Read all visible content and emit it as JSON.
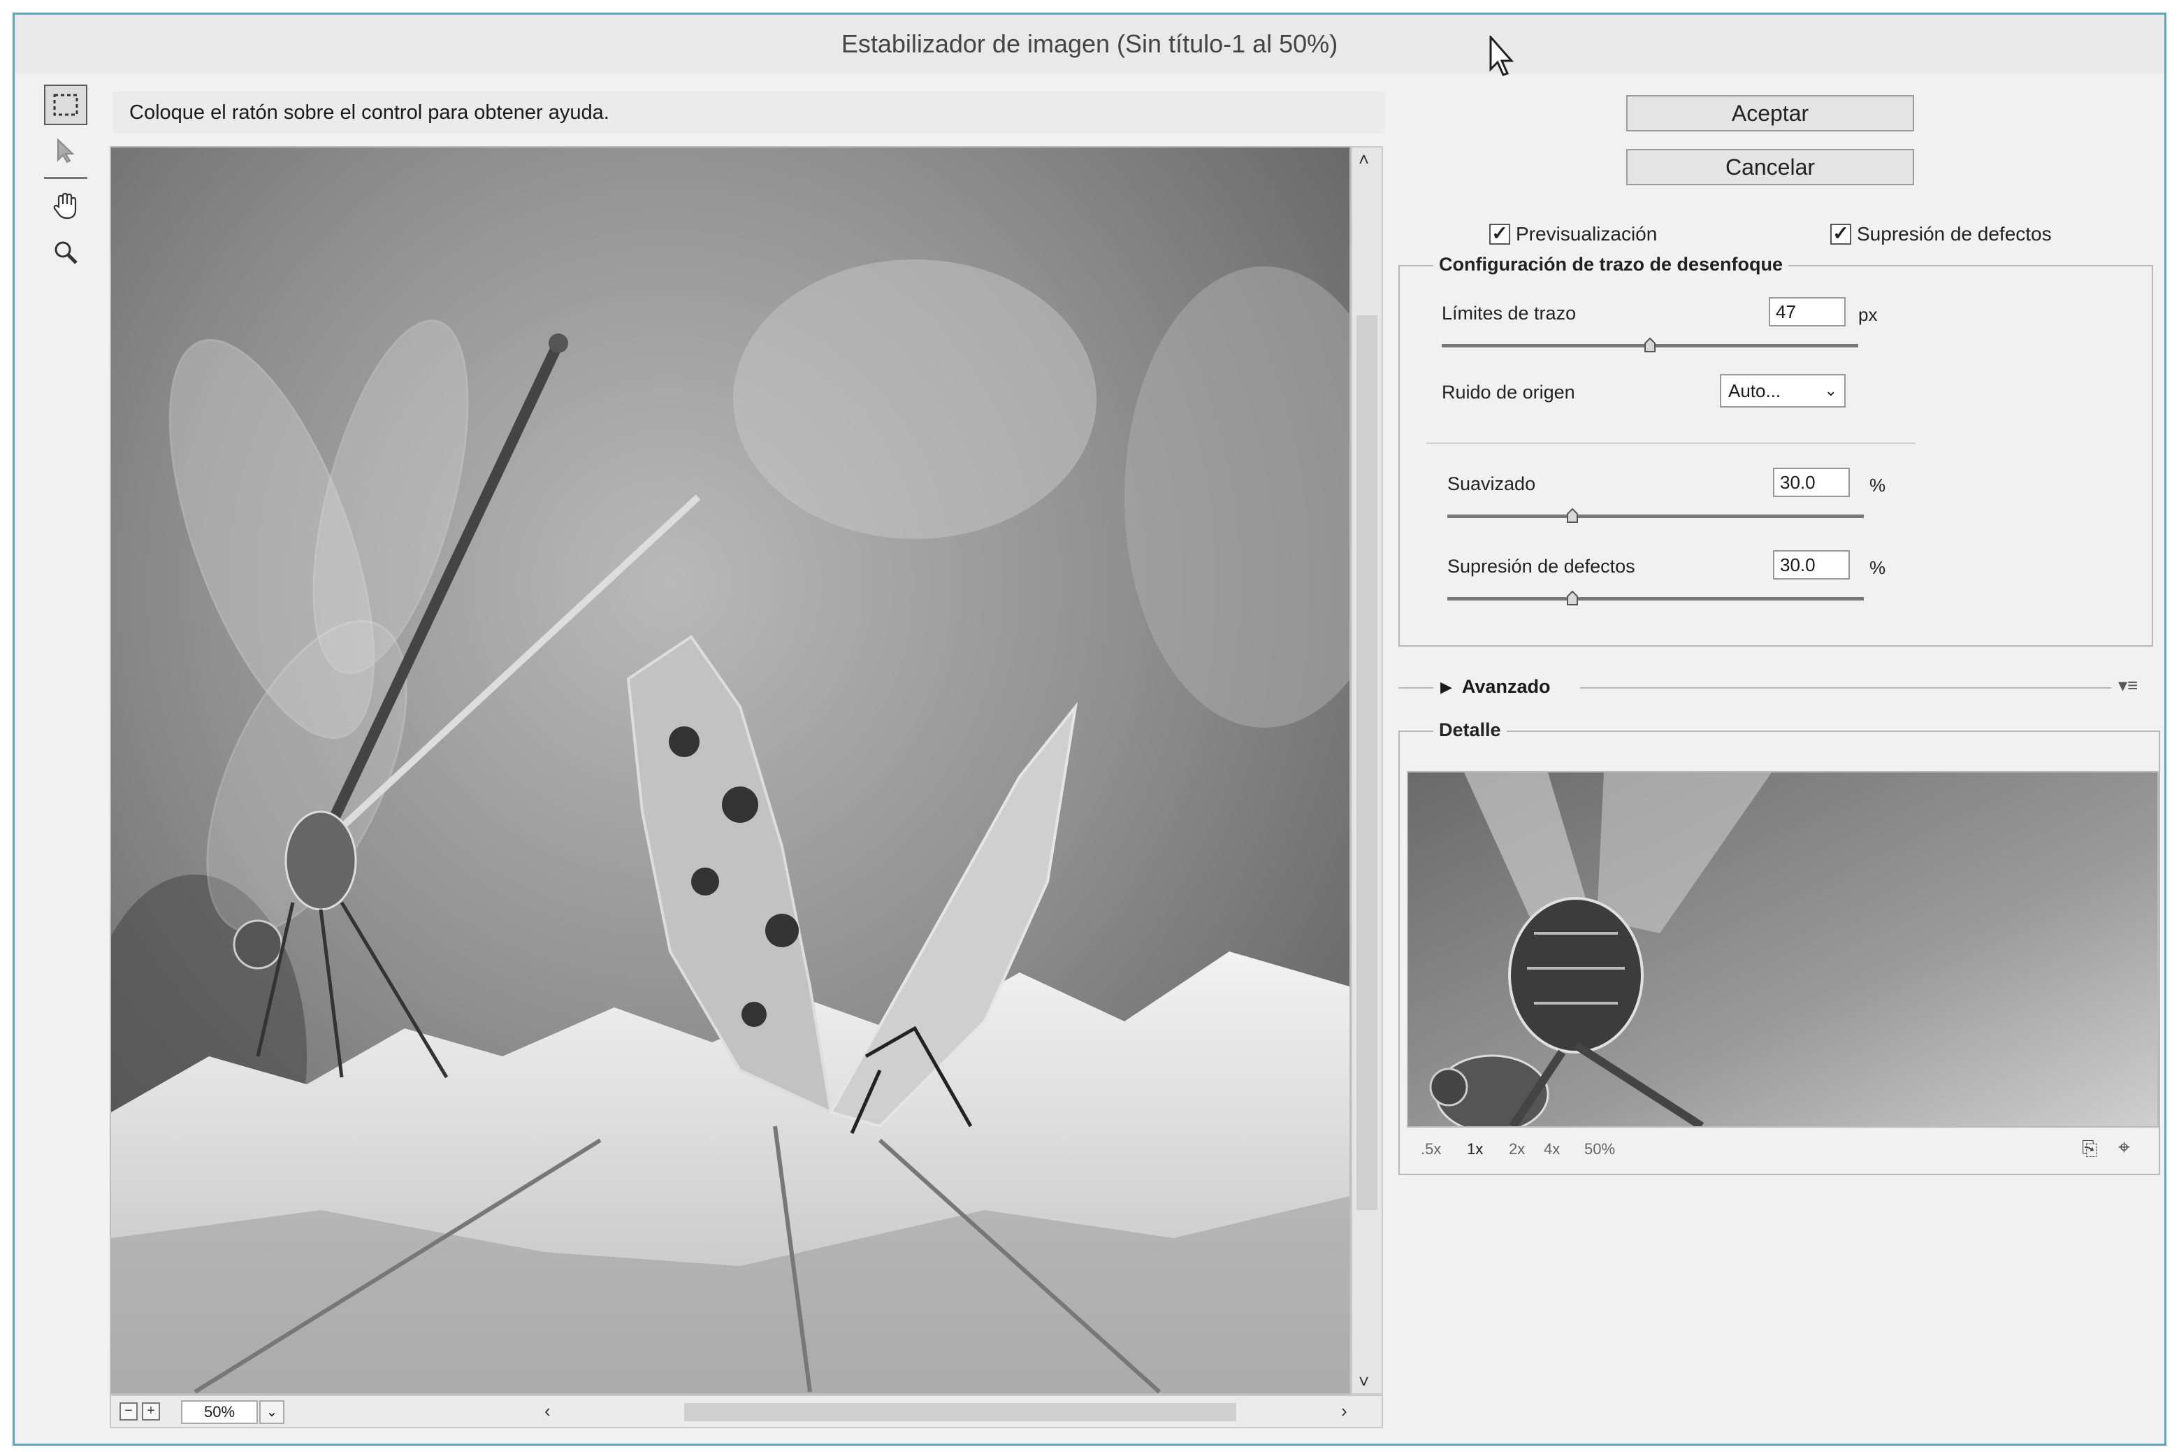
{
  "window": {
    "title": "Estabilizador de imagen (Sin título-1 al 50%)"
  },
  "help_text": "Coloque el ratón sobre el control para obtener ayuda.",
  "tools": [
    {
      "icon": "marquee-select-icon"
    },
    {
      "icon": "pointer-arrow-icon"
    },
    {
      "icon": "hand-icon"
    },
    {
      "icon": "zoom-icon"
    }
  ],
  "buttons": {
    "ok": "Aceptar",
    "cancel": "Cancelar"
  },
  "checkboxes": {
    "preview": {
      "label": "Previsualización",
      "checked": true
    },
    "artifact": {
      "label": "Supresión de defectos",
      "checked": true
    }
  },
  "blur_group": {
    "title": "Configuración de trazo de desenfoque",
    "trace_bounds": {
      "label": "Límites de trazo",
      "value": "47",
      "unit": "px",
      "slider_fraction": 0.5
    },
    "source_noise": {
      "label": "Ruido de origen",
      "value": "Auto..."
    },
    "smoothing": {
      "label": "Suavizado",
      "value": "30.0",
      "unit": "%",
      "slider_fraction": 0.3
    },
    "artifact_suppression": {
      "label": "Supresión de defectos",
      "value": "30.0",
      "unit": "%",
      "slider_fraction": 0.3
    }
  },
  "advanced": {
    "label": "Avanzado"
  },
  "detail": {
    "title": "Detalle",
    "zoom_options": [
      ".5x",
      "1x",
      "2x",
      "4x",
      "50%"
    ]
  },
  "zoom": {
    "value": "50%"
  },
  "colors": {
    "accent_border": "#5fa6bd",
    "dialog_bg": "#f1f1f1"
  }
}
